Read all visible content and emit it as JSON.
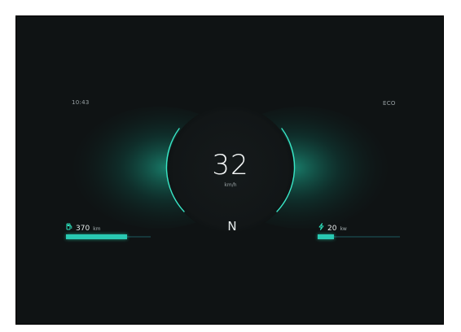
{
  "dashboard": {
    "time": "10:43",
    "mode": "ECO",
    "speed": {
      "value": "32",
      "unit": "km/h"
    },
    "gear": "N",
    "range": {
      "value": "370",
      "unit": "km",
      "icon": "fuel-pump-icon",
      "level": 0.72
    },
    "power": {
      "value": "20",
      "unit": "kw",
      "icon": "lightning-icon",
      "level": 0.2
    }
  },
  "colors": {
    "accent": "#2ee6c0",
    "background": "#0f1314",
    "text": "#e6ecec"
  }
}
